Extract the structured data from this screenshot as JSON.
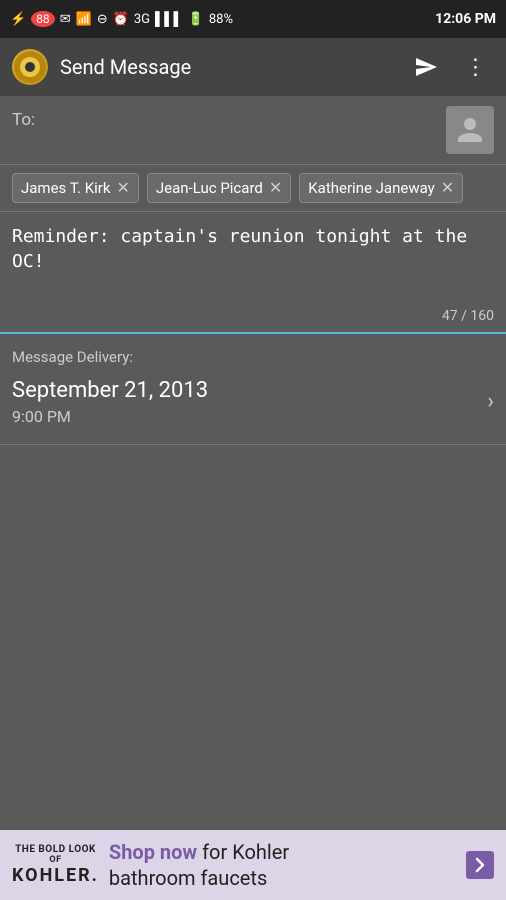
{
  "statusBar": {
    "leftIcons": "⚡ 88  ✉  📶  ⊖",
    "time": "12:06 PM",
    "battery": "88%",
    "network": "3G"
  },
  "titleBar": {
    "title": "Send Message",
    "sendLabel": "▶",
    "menuLabel": "⋮"
  },
  "toField": {
    "label": "To:",
    "placeholder": ""
  },
  "recipients": [
    {
      "name": "James T. Kirk",
      "id": "chip-kirk"
    },
    {
      "name": "Jean-Luc Picard",
      "id": "chip-picard"
    },
    {
      "name": "Katherine Janeway",
      "id": "chip-janeway"
    }
  ],
  "message": {
    "text": "Reminder: captain's reunion tonight at the OC!",
    "charCount": "47 / 160"
  },
  "delivery": {
    "sectionLabel": "Message Delivery:",
    "date": "September 21, 2013",
    "time": "9:00 PM"
  },
  "ad": {
    "boldTop": "THE BOLD LOOK",
    "boldOf": "OF",
    "brand": "KOHLER",
    "text": "Shop now for Kohler bathroom faucets",
    "shopNow": "Shop now"
  }
}
